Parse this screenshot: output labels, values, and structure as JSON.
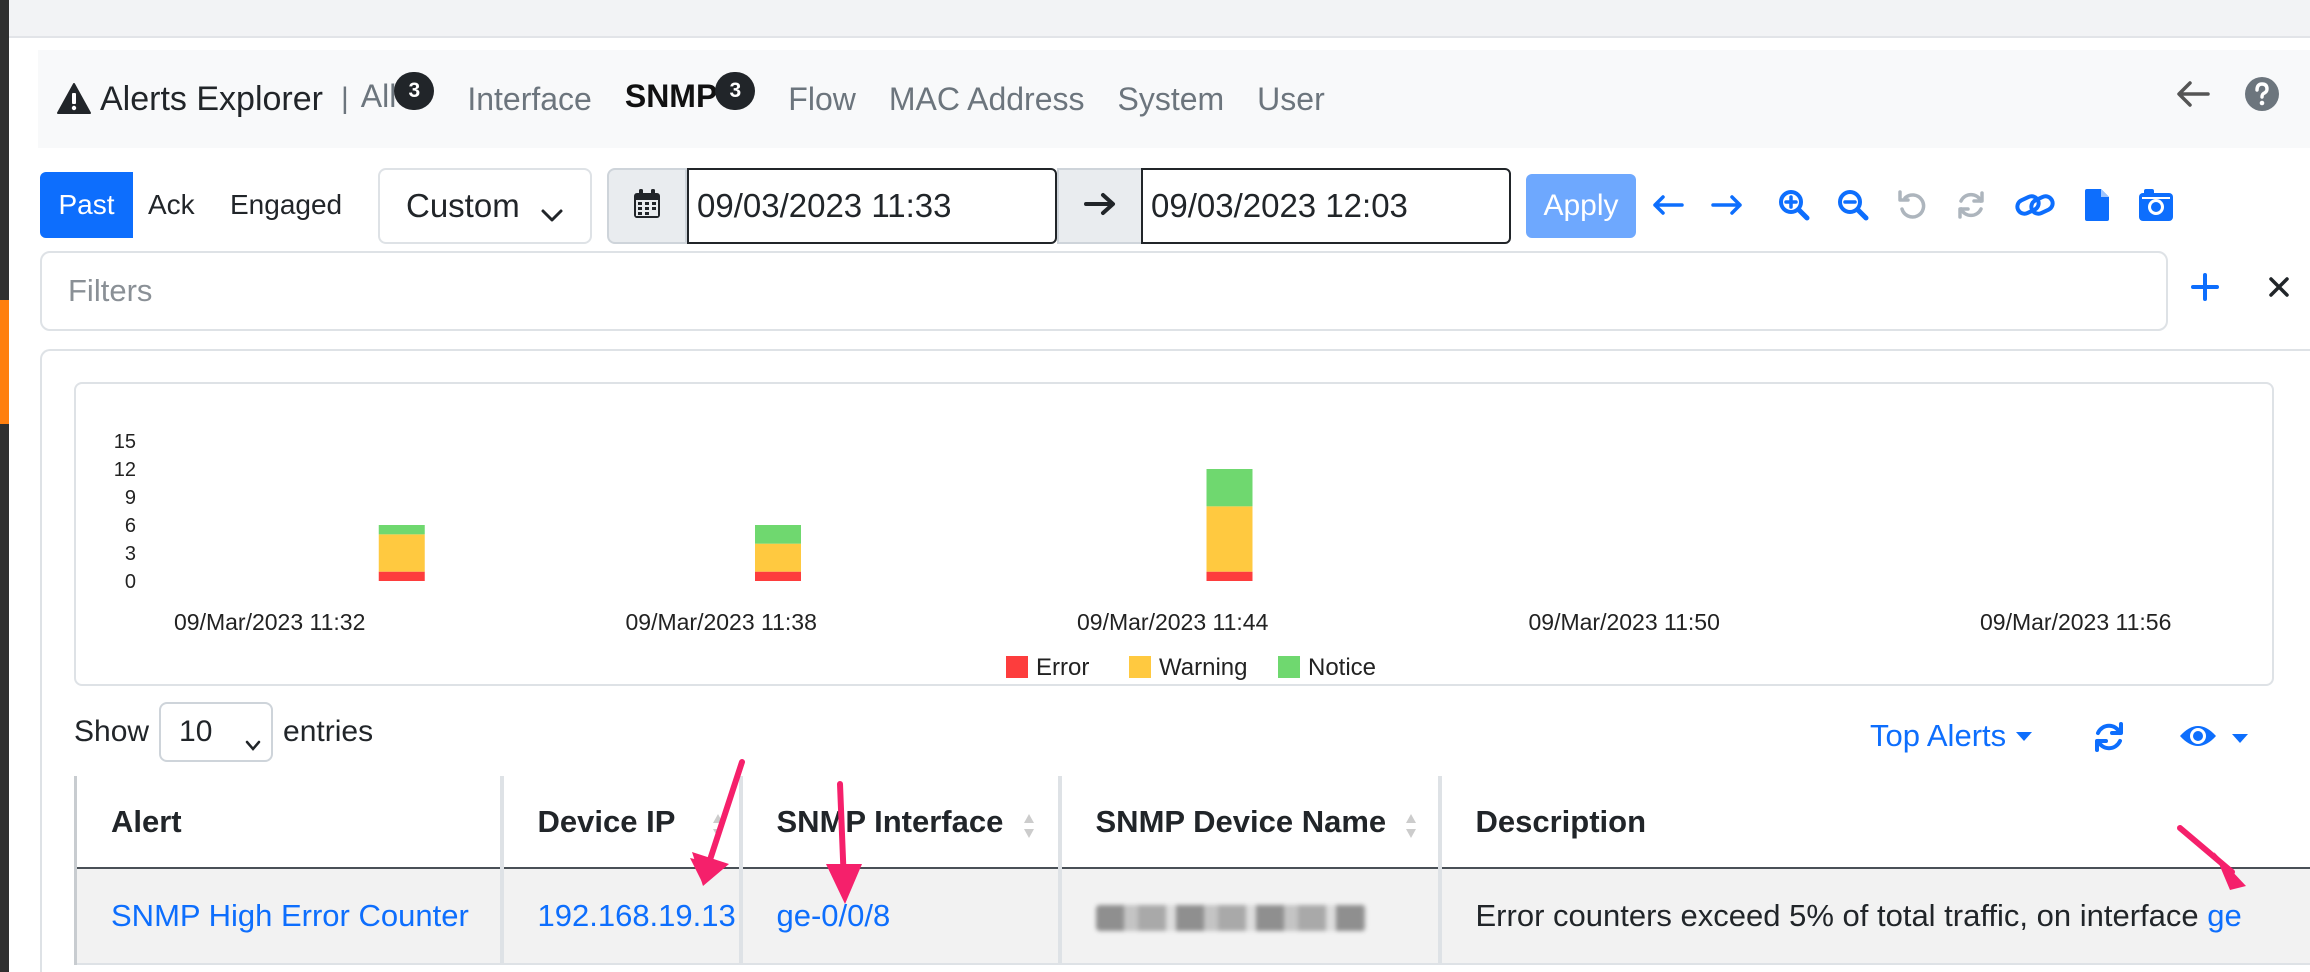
{
  "header": {
    "title": "Alerts Explorer",
    "separator": "|",
    "tabs": [
      {
        "label": "All",
        "badge": "3"
      },
      {
        "label": "Interface"
      },
      {
        "label": "SNMP",
        "badge": "3",
        "active": true
      },
      {
        "label": "Flow"
      },
      {
        "label": "MAC Address"
      },
      {
        "label": "System"
      },
      {
        "label": "User"
      }
    ],
    "icons": [
      "warning-icon",
      "arrow-left-icon",
      "help-icon"
    ]
  },
  "controls": {
    "status_buttons": [
      "Past",
      "Ack",
      "Engaged"
    ],
    "range_select": "Custom",
    "date_from": "09/03/2023 11:33",
    "date_to": "09/03/2023 12:03",
    "apply_label": "Apply",
    "tool_icons": [
      "arrow-left-icon",
      "arrow-right-icon",
      "zoom-in-icon",
      "zoom-out-icon",
      "undo-icon",
      "refresh-icon",
      "link-icon",
      "file-icon",
      "snapshot-icon"
    ]
  },
  "filters": {
    "placeholder": "Filters"
  },
  "chart_data": {
    "type": "bar",
    "stacked": true,
    "yticks": [
      "15",
      "12",
      "9",
      "6",
      "3",
      "0"
    ],
    "ylim": [
      0,
      15
    ],
    "xticks": [
      "09/Mar/2023 11:32",
      "09/Mar/2023 11:38",
      "09/Mar/2023 11:44",
      "09/Mar/2023 11:50",
      "09/Mar/2023 11:56"
    ],
    "categories": [
      "09/Mar/2023 11:35",
      "09/Mar/2023 11:40",
      "09/Mar/2023 11:46"
    ],
    "series": [
      {
        "name": "Error",
        "color": "#fd3d3d",
        "values": [
          1,
          1,
          1
        ]
      },
      {
        "name": "Warning",
        "color": "#ffc940",
        "values": [
          4,
          3,
          7
        ]
      },
      {
        "name": "Notice",
        "color": "#6fd86f",
        "values": [
          1,
          2,
          4
        ]
      }
    ],
    "legend_position": "bottom-center"
  },
  "table": {
    "show_label": "Show",
    "entries_value": "10",
    "entries_label": "entries",
    "top_alerts_label": "Top Alerts",
    "columns": [
      "Alert",
      "Device IP",
      "SNMP Interface",
      "SNMP Device Name",
      "Description"
    ],
    "rows": [
      {
        "alert": "SNMP High Error Counter",
        "device_ip": "192.168.19.13",
        "snmp_interface": "ge-0/0/8",
        "snmp_device_name": "",
        "description": "Error counters exceed 5% of total traffic, on interface ",
        "description_link": "ge"
      }
    ]
  },
  "colors": {
    "primary": "#0d6efd",
    "annotation_arrow": "#f5206b"
  }
}
